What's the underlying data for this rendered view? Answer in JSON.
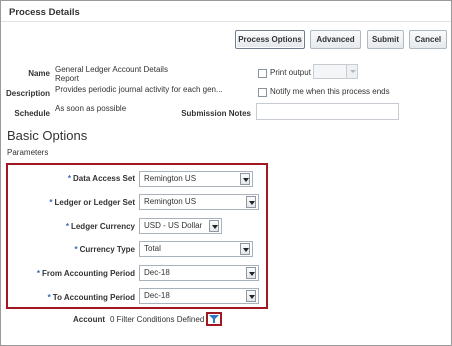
{
  "header": {
    "title": "Process Details"
  },
  "toolbar": {
    "process_options": "Process Options",
    "advanced": "Advanced",
    "submit": "Submit",
    "cancel": "Cancel"
  },
  "details": {
    "name_label": "Name",
    "name_value_line1": "General Ledger Account Details",
    "name_value_line2": "Report",
    "description_label": "Description",
    "description_value": "Provides periodic journal activity for each gen...",
    "schedule_label": "Schedule",
    "schedule_value": "As soon as possible",
    "print_output_label": "Print output",
    "notify_label": "Notify me when this process ends",
    "submission_notes_label": "Submission Notes",
    "submission_notes_value": ""
  },
  "basic_options": {
    "title": "Basic Options",
    "parameters_label": "Parameters",
    "required_marker": "*",
    "fields": [
      {
        "label": "Data Access Set",
        "value": "Remington US",
        "required": true
      },
      {
        "label": "Ledger or Ledger Set",
        "value": "Remington US",
        "required": true
      },
      {
        "label": "Ledger Currency",
        "value": "USD - US Dollar",
        "required": true
      },
      {
        "label": "Currency Type",
        "value": "Total",
        "required": true
      },
      {
        "label": "From Accounting Period",
        "value": "Dec-18",
        "required": true
      },
      {
        "label": "To Accounting Period",
        "value": "Dec-18",
        "required": true
      }
    ],
    "account_label": "Account",
    "account_value": "0 Filter Conditions Defined"
  },
  "colors": {
    "highlight": "#a01821",
    "required": "#2e6bbd",
    "filter_icon": "#2a78c6"
  }
}
